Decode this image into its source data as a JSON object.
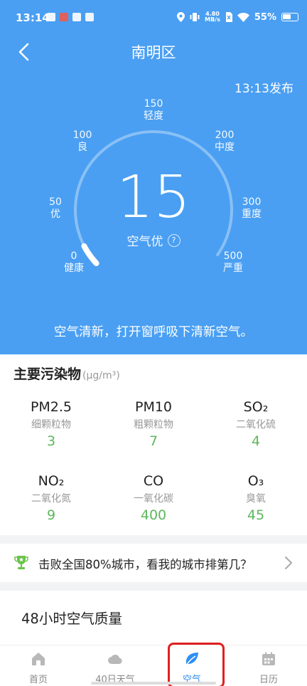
{
  "status_bar": {
    "time": "13:14",
    "net_speed_value": "4.80",
    "net_speed_unit": "MB/s",
    "battery": "55%"
  },
  "header": {
    "title": "南明区",
    "publish_time": "13:13发布"
  },
  "gauge": {
    "aqi_value": "15",
    "quality_label": "空气优",
    "help_symbol": "?",
    "aqi_fraction_of_scale": 0.03,
    "ticks": [
      {
        "value": "0",
        "label": "健康"
      },
      {
        "value": "50",
        "label": "优"
      },
      {
        "value": "100",
        "label": "良"
      },
      {
        "value": "150",
        "label": "轻度"
      },
      {
        "value": "200",
        "label": "中度"
      },
      {
        "value": "300",
        "label": "重度"
      },
      {
        "value": "500",
        "label": "严重"
      }
    ]
  },
  "advice": "空气清新，打开窗呼吸下清新空气。",
  "pollutants": {
    "title": "主要污染物",
    "unit": "(μg/m³)",
    "items": [
      {
        "name": "PM2.5",
        "cn": "细颗粒物",
        "value": "3"
      },
      {
        "name": "PM10",
        "cn": "粗颗粒物",
        "value": "7"
      },
      {
        "name": "SO₂",
        "cn": "二氧化硫",
        "value": "4"
      },
      {
        "name": "NO₂",
        "cn": "二氧化氮",
        "value": "9"
      },
      {
        "name": "CO",
        "cn": "一氧化碳",
        "value": "400"
      },
      {
        "name": "O₃",
        "cn": "臭氧",
        "value": "45"
      }
    ]
  },
  "ranking": {
    "text": "击败全国80%城市，看我的城市排第几？"
  },
  "hourly": {
    "title": "48小时空气质量"
  },
  "tabs": [
    {
      "label": "首页",
      "icon": "home-icon"
    },
    {
      "label": "40日天气",
      "icon": "cloud-icon"
    },
    {
      "label": "空气",
      "icon": "leaf-icon"
    },
    {
      "label": "日历",
      "icon": "calendar-icon"
    }
  ],
  "colors": {
    "hero_bg": "#4a9ff2",
    "good_value": "#5cb85c",
    "active_tab": "#2f8ef5",
    "highlight": "#e02020"
  }
}
